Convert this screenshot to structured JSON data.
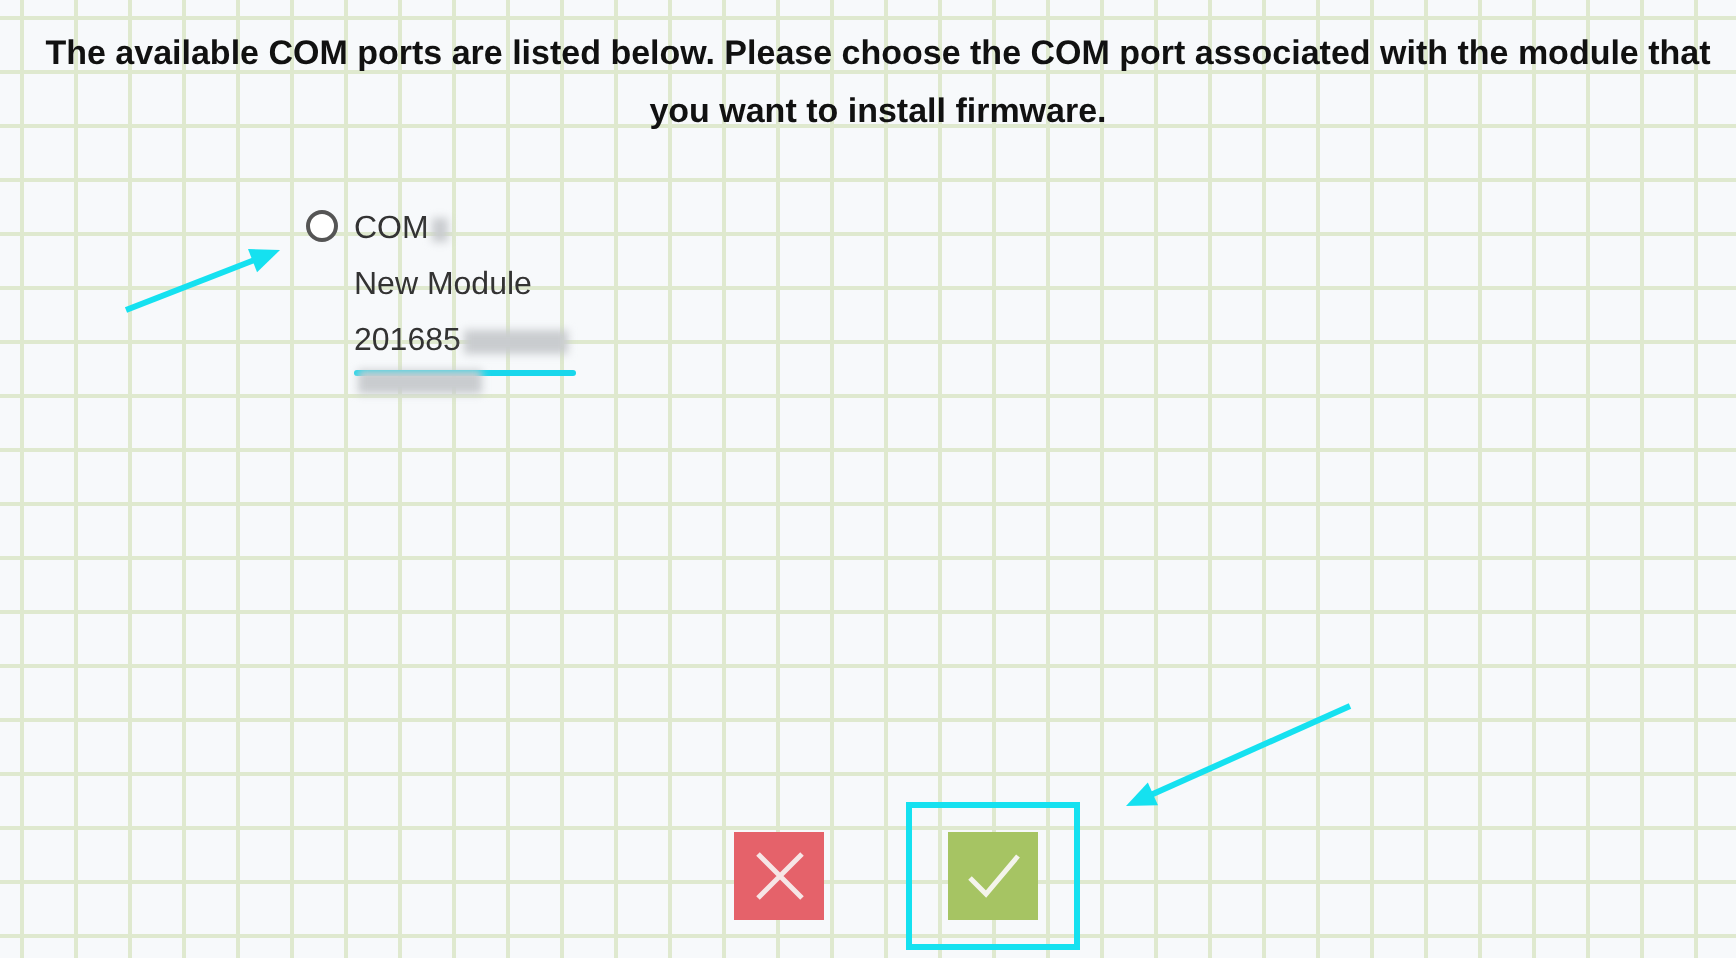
{
  "instruction": "The available COM ports are listed below. Please choose the COM port associated with the module that you want to install firmware.",
  "ports": [
    {
      "selected": false,
      "port": "COM",
      "name": "New Module",
      "serial": "201685"
    }
  ],
  "buttons": [
    {
      "kind": "cancel",
      "highlighted": false
    },
    {
      "kind": "confirm",
      "highlighted": true
    }
  ]
}
